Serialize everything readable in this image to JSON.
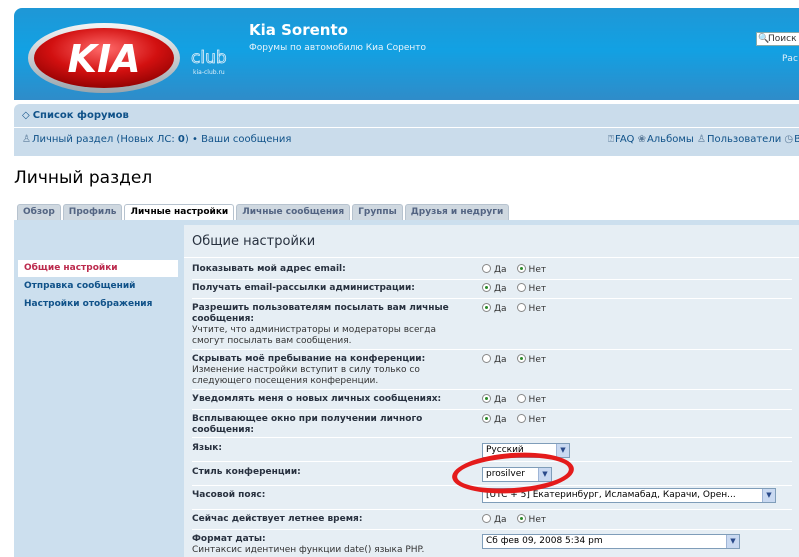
{
  "header": {
    "site_title": "Kia Sorento",
    "site_description": "Форумы по автомобилю Киа Соренто",
    "logo_text": "KIA",
    "logo_club": "club",
    "logo_url": "kia-club.ru",
    "search_placeholder": "Поиск",
    "search_advanced": "Рас"
  },
  "nav": {
    "breadcrumb": "Список форумов",
    "left_links": {
      "personal": "Личный раздел (Новых ЛС: ",
      "new_count": "0",
      "sep": ") • ",
      "messages": "Ваши сообщения"
    },
    "right_links": [
      "FAQ",
      "Альбомы",
      "Пользователи",
      "В"
    ]
  },
  "page_title": "Личный раздел",
  "tabs": [
    "Обзор",
    "Профиль",
    "Личные настройки",
    "Личные сообщения",
    "Группы",
    "Друзья и недруги"
  ],
  "active_tab": 2,
  "sidebar": [
    "Общие настройки",
    "Отправка сообщений",
    "Настройки отображения"
  ],
  "section_title": "Общие настройки",
  "options": {
    "yes": "Да",
    "no": "Нет"
  },
  "settings": [
    {
      "label": "Показывать мой адрес email:",
      "explain": "",
      "value": "no"
    },
    {
      "label": "Получать email-рассылки администрации:",
      "explain": "",
      "value": "yes"
    },
    {
      "label": "Разрешить пользователям посылать вам личные сообщения:",
      "explain": "Учтите, что администраторы и модераторы всегда смогут посылать вам сообщения.",
      "value": "yes"
    },
    {
      "label": "Скрывать моё пребывание на конференции:",
      "explain": "Изменение настройки вступит в силу только со следующего посещения конференции.",
      "value": "no"
    },
    {
      "label": "Уведомлять меня о новых личных сообщениях:",
      "explain": "",
      "value": "yes"
    },
    {
      "label": "Всплывающее окно при получении личного сообщения:",
      "explain": "",
      "value": "yes"
    }
  ],
  "language": {
    "label": "Язык:",
    "value": "Русский"
  },
  "style": {
    "label": "Стиль конференции:",
    "value": "prosilver"
  },
  "timezone": {
    "label": "Часовой пояс:",
    "value": "[UTC + 5] Екатеринбург, Исламабад, Карачи, Орен..."
  },
  "dst": {
    "label": "Сейчас действует летнее время:",
    "value": "no"
  },
  "date_format": {
    "label": "Формат даты:",
    "explain": "Синтаксис идентичен функции date() языка PHP.",
    "value": "Сб фев 09, 2008 5:34 pm"
  },
  "colors": {
    "header_blue": "#1f97d6",
    "nav_bg": "#cadceb",
    "panel_bg": "#ccdfee",
    "content_bg": "#e6eef4",
    "active_side": "#bc2a4d",
    "annotation_red": "#e41b1b"
  }
}
